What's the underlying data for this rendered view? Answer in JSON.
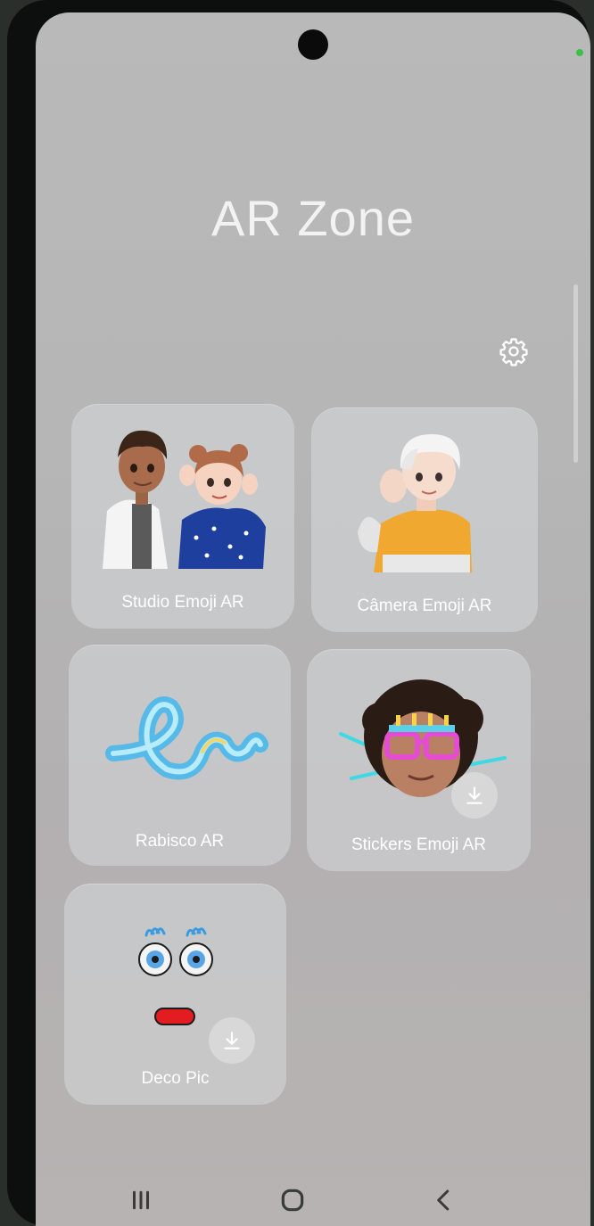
{
  "app": {
    "title": "AR Zone"
  },
  "icons": {
    "settings": "gear-icon",
    "download": "download-icon",
    "nav_recents": "recents-icon",
    "nav_home": "home-icon",
    "nav_back": "back-icon"
  },
  "tiles": [
    {
      "label": "Studio Emoji AR",
      "art": "two-avatars-illustration",
      "download": false
    },
    {
      "label": "Câmera Emoji AR",
      "art": "waving-avatar-illustration",
      "download": false
    },
    {
      "label": "Rabisco AR",
      "art": "neon-scribble-illustration",
      "download": false
    },
    {
      "label": "Stickers Emoji AR",
      "art": "party-glasses-avatar-illustration",
      "download": true
    },
    {
      "label": "Deco Pic",
      "art": "cartoon-face-illustration",
      "download": true
    }
  ],
  "colors": {
    "screen_background": "#b7b7b7",
    "title_text": "#f2f2f2",
    "tile_background": "#d6d8da",
    "indicator_led": "#39c24a"
  }
}
